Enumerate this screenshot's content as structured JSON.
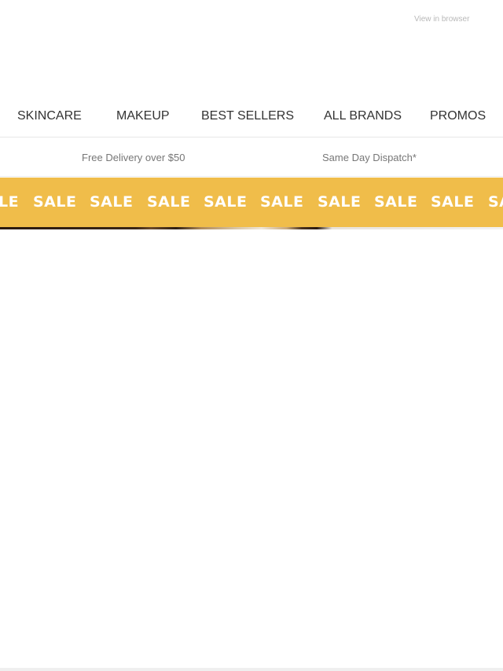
{
  "header": {
    "view_in_browser": "View in browser"
  },
  "nav": {
    "items": [
      "SKINCARE",
      "MAKEUP",
      "BEST SELLERS",
      "ALL BRANDS",
      "PROMOS"
    ]
  },
  "usp": {
    "delivery": "Free Delivery over $50",
    "dispatch": "Same Day Dispatch*"
  },
  "banner": {
    "sale_word": "SALE",
    "partial_left": "LE",
    "partial_right": "SA",
    "background_color": "#f0bd4a",
    "text_color": "#ffffff"
  }
}
